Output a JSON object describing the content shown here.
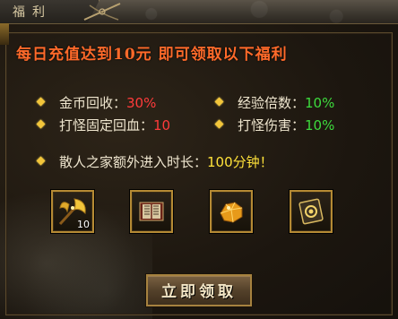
{
  "tab": {
    "label": "福利"
  },
  "headline": "每日充值达到10元 即可领取以下福利",
  "benefits": [
    {
      "label": "金币回收：",
      "value": "30%",
      "color": "#ff3b3b"
    },
    {
      "label": "经验倍数：",
      "value": "10%",
      "color": "#3ddb3d"
    },
    {
      "label": "打怪固定回血：",
      "value": "10",
      "color": "#ff3b3b"
    },
    {
      "label": "打怪伤害：",
      "value": "10%",
      "color": "#3ddb3d"
    },
    {
      "label": "散人之家额外进入时长：",
      "value": "100分钟！",
      "color": "#ffe23a"
    }
  ],
  "rewards": [
    {
      "icon": "golden-axe-icon",
      "qty": "10"
    },
    {
      "icon": "book-icon",
      "qty": ""
    },
    {
      "icon": "gold-ore-icon",
      "qty": ""
    },
    {
      "icon": "token-icon",
      "qty": ""
    }
  ],
  "claim_button": {
    "label": "立即领取"
  }
}
